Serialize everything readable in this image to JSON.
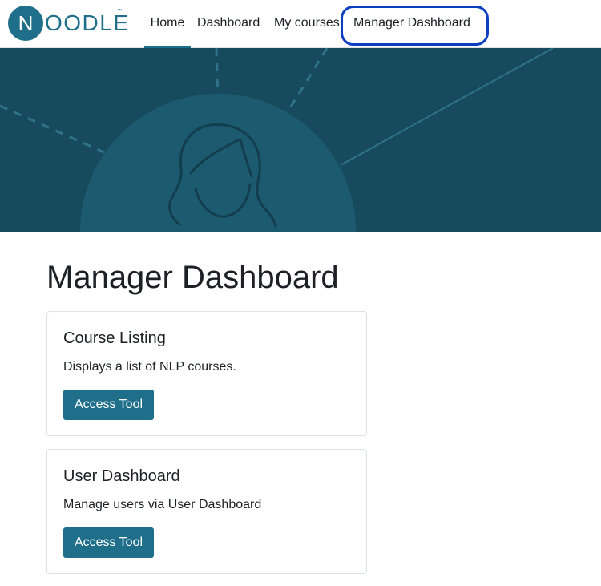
{
  "brand": {
    "logo_initial": "N",
    "logo_rest": "OODLE",
    "logo_tm": "™"
  },
  "nav": {
    "items": [
      {
        "label": "Home",
        "active": true
      },
      {
        "label": "Dashboard",
        "active": false
      },
      {
        "label": "My courses",
        "active": false
      },
      {
        "label": "Manager Dashboard",
        "active": false,
        "highlighted": true
      }
    ]
  },
  "page": {
    "title": "Manager Dashboard"
  },
  "cards": [
    {
      "title": "Course Listing",
      "description": "Displays a list of NLP courses.",
      "button_label": "Access Tool"
    },
    {
      "title": "User Dashboard",
      "description": "Manage users via User Dashboard",
      "button_label": "Access Tool"
    }
  ],
  "colors": {
    "brand": "#1f6f8b",
    "banner_bg": "#184a5e",
    "banner_circle": "#1c5a70",
    "highlight": "#0b3fbf"
  },
  "icons": {
    "banner_illustration": "person-avatar-icon"
  }
}
